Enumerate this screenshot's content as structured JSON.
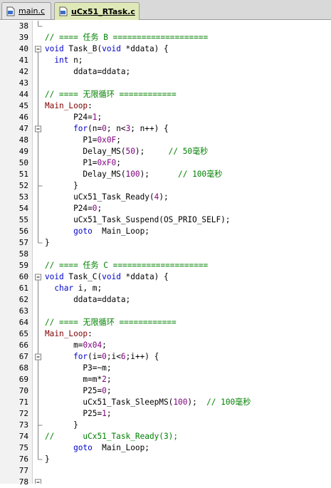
{
  "tabs": [
    {
      "label": "main.c",
      "active": false,
      "icon": "c-file-icon"
    },
    {
      "label": "uCx51_RTask.c",
      "active": true,
      "icon": "c-file-icon"
    }
  ],
  "colors": {
    "keyword": "#0000cc",
    "comment": "#008000",
    "number": "#800080",
    "label": "#800000",
    "active_tab": "#dfe9b8"
  },
  "lines": [
    {
      "n": "38",
      "tokens": [],
      "fold": "end"
    },
    {
      "n": "39",
      "tokens": [
        {
          "t": "// ==== 任务 B ====================",
          "c": "cm"
        }
      ]
    },
    {
      "n": "40",
      "fold": "open",
      "tokens": [
        {
          "t": "void",
          "c": "kw"
        },
        {
          "t": " Task_B("
        },
        {
          "t": "void",
          "c": "kw"
        },
        {
          "t": " *ddata) {"
        }
      ]
    },
    {
      "n": "41",
      "tokens": [
        {
          "t": "  "
        },
        {
          "t": "int",
          "c": "kw"
        },
        {
          "t": " n;"
        }
      ]
    },
    {
      "n": "42",
      "tokens": [
        {
          "t": "      ddata=ddata;"
        }
      ]
    },
    {
      "n": "43",
      "tokens": []
    },
    {
      "n": "44",
      "tokens": [
        {
          "t": "// ==== 无限循环 ============",
          "c": "cm"
        }
      ]
    },
    {
      "n": "45",
      "tokens": [
        {
          "t": "Main_Loop",
          "c": "lbl"
        },
        {
          "t": ":"
        }
      ]
    },
    {
      "n": "46",
      "tokens": [
        {
          "t": "      P24="
        },
        {
          "t": "1",
          "c": "num"
        },
        {
          "t": ";"
        }
      ]
    },
    {
      "n": "47",
      "fold": "open",
      "tokens": [
        {
          "t": "      "
        },
        {
          "t": "for",
          "c": "kw"
        },
        {
          "t": "(n="
        },
        {
          "t": "0",
          "c": "num"
        },
        {
          "t": "; n<"
        },
        {
          "t": "3",
          "c": "num"
        },
        {
          "t": "; n++) {"
        }
      ]
    },
    {
      "n": "48",
      "tokens": [
        {
          "t": "        P1="
        },
        {
          "t": "0x0F",
          "c": "num"
        },
        {
          "t": ";"
        }
      ]
    },
    {
      "n": "49",
      "tokens": [
        {
          "t": "        Delay_MS("
        },
        {
          "t": "50",
          "c": "num"
        },
        {
          "t": ");     "
        },
        {
          "t": "// 50毫秒",
          "c": "cm"
        }
      ]
    },
    {
      "n": "50",
      "tokens": [
        {
          "t": "        P1="
        },
        {
          "t": "0xF0",
          "c": "num"
        },
        {
          "t": ";"
        }
      ]
    },
    {
      "n": "51",
      "tokens": [
        {
          "t": "        Delay_MS("
        },
        {
          "t": "100",
          "c": "num"
        },
        {
          "t": ");      "
        },
        {
          "t": "// 100毫秒",
          "c": "cm"
        }
      ]
    },
    {
      "n": "52",
      "fold": "end",
      "tokens": [
        {
          "t": "      }"
        }
      ]
    },
    {
      "n": "53",
      "tokens": [
        {
          "t": "      uCx51_Task_Ready("
        },
        {
          "t": "4",
          "c": "num"
        },
        {
          "t": ");"
        }
      ]
    },
    {
      "n": "54",
      "tokens": [
        {
          "t": "      P24="
        },
        {
          "t": "0",
          "c": "num"
        },
        {
          "t": ";"
        }
      ]
    },
    {
      "n": "55",
      "tokens": [
        {
          "t": "      uCx51_Task_Suspend(OS_PRIO_SELF);"
        }
      ]
    },
    {
      "n": "56",
      "tokens": [
        {
          "t": "      "
        },
        {
          "t": "goto",
          "c": "kw"
        },
        {
          "t": "  Main_Loop;"
        }
      ]
    },
    {
      "n": "57",
      "fold": "end",
      "tokens": [
        {
          "t": "}"
        }
      ]
    },
    {
      "n": "58",
      "tokens": []
    },
    {
      "n": "59",
      "tokens": [
        {
          "t": "// ==== 任务 C ====================",
          "c": "cm"
        }
      ]
    },
    {
      "n": "60",
      "fold": "open",
      "tokens": [
        {
          "t": "void",
          "c": "kw"
        },
        {
          "t": " Task_C("
        },
        {
          "t": "void",
          "c": "kw"
        },
        {
          "t": " *ddata) {"
        }
      ]
    },
    {
      "n": "61",
      "tokens": [
        {
          "t": "  "
        },
        {
          "t": "char",
          "c": "kw"
        },
        {
          "t": " i, m;"
        }
      ]
    },
    {
      "n": "62",
      "tokens": [
        {
          "t": "      ddata=ddata;"
        }
      ]
    },
    {
      "n": "63",
      "tokens": []
    },
    {
      "n": "64",
      "tokens": [
        {
          "t": "// ==== 无限循环 ============",
          "c": "cm"
        }
      ]
    },
    {
      "n": "65",
      "tokens": [
        {
          "t": "Main_Loop",
          "c": "lbl"
        },
        {
          "t": ":"
        }
      ]
    },
    {
      "n": "66",
      "tokens": [
        {
          "t": "      m="
        },
        {
          "t": "0x04",
          "c": "num"
        },
        {
          "t": ";"
        }
      ]
    },
    {
      "n": "67",
      "fold": "open",
      "tokens": [
        {
          "t": "      "
        },
        {
          "t": "for",
          "c": "kw"
        },
        {
          "t": "(i="
        },
        {
          "t": "0",
          "c": "num"
        },
        {
          "t": ";i<"
        },
        {
          "t": "6",
          "c": "num"
        },
        {
          "t": ";i++) {"
        }
      ]
    },
    {
      "n": "68",
      "tokens": [
        {
          "t": "        P3=~m;"
        }
      ]
    },
    {
      "n": "69",
      "tokens": [
        {
          "t": "        m=m*"
        },
        {
          "t": "2",
          "c": "num"
        },
        {
          "t": ";"
        }
      ]
    },
    {
      "n": "70",
      "tokens": [
        {
          "t": "        P25="
        },
        {
          "t": "0",
          "c": "num"
        },
        {
          "t": ";"
        }
      ]
    },
    {
      "n": "71",
      "tokens": [
        {
          "t": "        uCx51_Task_SleepMS("
        },
        {
          "t": "100",
          "c": "num"
        },
        {
          "t": ");  "
        },
        {
          "t": "// 100毫秒",
          "c": "cm"
        }
      ]
    },
    {
      "n": "72",
      "tokens": [
        {
          "t": "        P25="
        },
        {
          "t": "1",
          "c": "num"
        },
        {
          "t": ";"
        }
      ]
    },
    {
      "n": "73",
      "fold": "end",
      "tokens": [
        {
          "t": "      }"
        }
      ]
    },
    {
      "n": "74",
      "tokens": [
        {
          "t": "//      uCx51_Task_Ready(3);",
          "c": "cm"
        }
      ]
    },
    {
      "n": "75",
      "tokens": [
        {
          "t": "      "
        },
        {
          "t": "goto",
          "c": "kw"
        },
        {
          "t": "  Main_Loop;"
        }
      ]
    },
    {
      "n": "76",
      "fold": "end",
      "tokens": [
        {
          "t": "}"
        }
      ]
    },
    {
      "n": "77",
      "tokens": []
    },
    {
      "n": "78",
      "tokens": [],
      "fold": "open-partial"
    }
  ]
}
